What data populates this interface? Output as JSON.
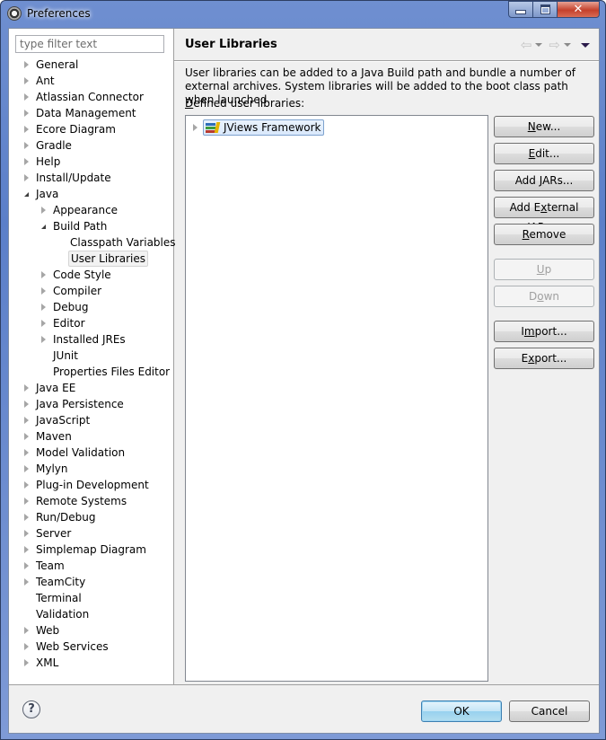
{
  "window": {
    "title": "Preferences",
    "controls": {
      "minimize": "minimize",
      "maximize": "maximize",
      "close": "close"
    }
  },
  "filter": {
    "placeholder": "type filter text",
    "value": ""
  },
  "tree": [
    {
      "label": "General",
      "level": 0,
      "state": "collapsed"
    },
    {
      "label": "Ant",
      "level": 0,
      "state": "collapsed"
    },
    {
      "label": "Atlassian Connector",
      "level": 0,
      "state": "collapsed"
    },
    {
      "label": "Data Management",
      "level": 0,
      "state": "collapsed"
    },
    {
      "label": "Ecore Diagram",
      "level": 0,
      "state": "collapsed"
    },
    {
      "label": "Gradle",
      "level": 0,
      "state": "collapsed"
    },
    {
      "label": "Help",
      "level": 0,
      "state": "collapsed"
    },
    {
      "label": "Install/Update",
      "level": 0,
      "state": "collapsed"
    },
    {
      "label": "Java",
      "level": 0,
      "state": "expanded"
    },
    {
      "label": "Appearance",
      "level": 1,
      "state": "collapsed"
    },
    {
      "label": "Build Path",
      "level": 1,
      "state": "expanded"
    },
    {
      "label": "Classpath Variables",
      "level": 2,
      "state": "leaf"
    },
    {
      "label": "User Libraries",
      "level": 2,
      "state": "leaf",
      "selected": true
    },
    {
      "label": "Code Style",
      "level": 1,
      "state": "collapsed"
    },
    {
      "label": "Compiler",
      "level": 1,
      "state": "collapsed"
    },
    {
      "label": "Debug",
      "level": 1,
      "state": "collapsed"
    },
    {
      "label": "Editor",
      "level": 1,
      "state": "collapsed"
    },
    {
      "label": "Installed JREs",
      "level": 1,
      "state": "collapsed"
    },
    {
      "label": "JUnit",
      "level": 1,
      "state": "leaf"
    },
    {
      "label": "Properties Files Editor",
      "level": 1,
      "state": "leaf"
    },
    {
      "label": "Java EE",
      "level": 0,
      "state": "collapsed"
    },
    {
      "label": "Java Persistence",
      "level": 0,
      "state": "collapsed"
    },
    {
      "label": "JavaScript",
      "level": 0,
      "state": "collapsed"
    },
    {
      "label": "Maven",
      "level": 0,
      "state": "collapsed"
    },
    {
      "label": "Model Validation",
      "level": 0,
      "state": "collapsed"
    },
    {
      "label": "Mylyn",
      "level": 0,
      "state": "collapsed"
    },
    {
      "label": "Plug-in Development",
      "level": 0,
      "state": "collapsed"
    },
    {
      "label": "Remote Systems",
      "level": 0,
      "state": "collapsed"
    },
    {
      "label": "Run/Debug",
      "level": 0,
      "state": "collapsed"
    },
    {
      "label": "Server",
      "level": 0,
      "state": "collapsed"
    },
    {
      "label": "Simplemap Diagram",
      "level": 0,
      "state": "collapsed"
    },
    {
      "label": "Team",
      "level": 0,
      "state": "collapsed"
    },
    {
      "label": "TeamCity",
      "level": 0,
      "state": "collapsed"
    },
    {
      "label": "Terminal",
      "level": 0,
      "state": "leaf"
    },
    {
      "label": "Validation",
      "level": 0,
      "state": "leaf"
    },
    {
      "label": "Web",
      "level": 0,
      "state": "collapsed"
    },
    {
      "label": "Web Services",
      "level": 0,
      "state": "collapsed"
    },
    {
      "label": "XML",
      "level": 0,
      "state": "collapsed"
    }
  ],
  "page": {
    "title": "User Libraries",
    "nav": {
      "back": "back",
      "forward": "forward",
      "menu": "view-menu"
    },
    "description": "User libraries can be added to a Java Build path and bundle a number of external archives. System libraries will be added to the boot class path when launched.",
    "defined_label_mnemonic": "D",
    "defined_label_rest": "efined user libraries:",
    "libraries": [
      {
        "label": "JViews Framework",
        "state": "collapsed",
        "selected": true
      }
    ],
    "buttons": [
      {
        "id": "new",
        "pre": "",
        "mn": "N",
        "post": "ew...",
        "enabled": true
      },
      {
        "id": "edit",
        "pre": "",
        "mn": "E",
        "post": "dit...",
        "enabled": true
      },
      {
        "id": "add-jars",
        "pre": "Add ",
        "mn": "J",
        "post": "ARs...",
        "enabled": true
      },
      {
        "id": "add-external-jars",
        "pre": "Add E",
        "mn": "x",
        "post": "ternal JARs...",
        "enabled": true
      },
      {
        "id": "remove",
        "pre": "",
        "mn": "R",
        "post": "emove",
        "enabled": true
      },
      {
        "id": "up",
        "pre": "",
        "mn": "U",
        "post": "p",
        "enabled": false
      },
      {
        "id": "down",
        "pre": "D",
        "mn": "o",
        "post": "wn",
        "enabled": false
      },
      {
        "id": "import",
        "pre": "I",
        "mn": "m",
        "post": "port...",
        "enabled": true
      },
      {
        "id": "export",
        "pre": "E",
        "mn": "x",
        "post": "port...",
        "enabled": true
      }
    ]
  },
  "footer": {
    "help_glyph": "?",
    "ok_label": "OK",
    "cancel_label": "Cancel"
  }
}
